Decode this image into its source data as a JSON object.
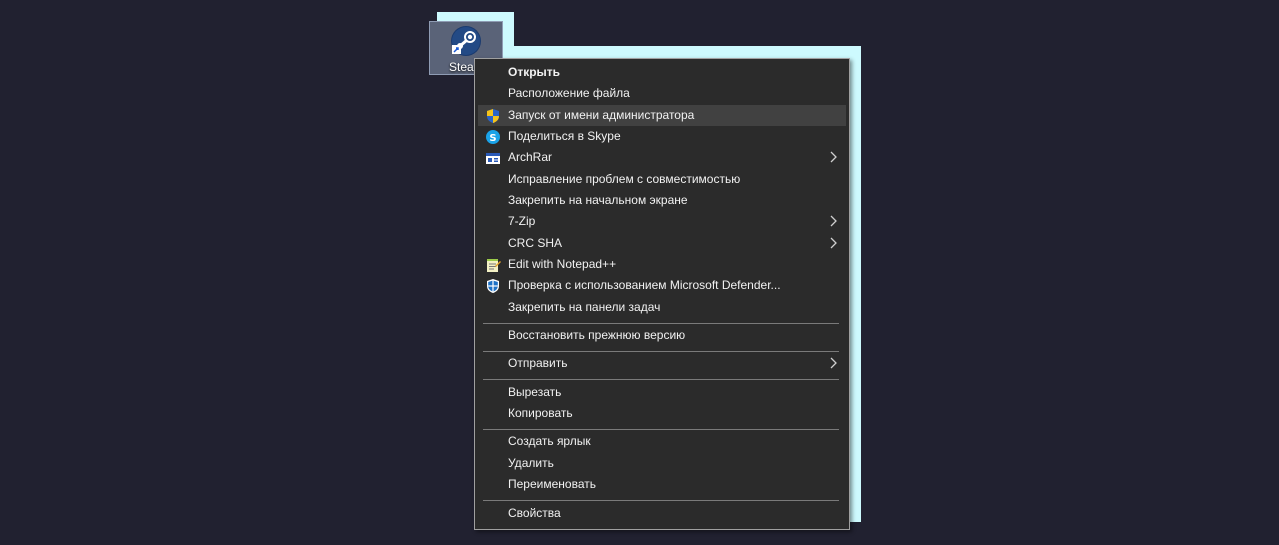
{
  "desktop_icon": {
    "label": "Steam",
    "icon": "steam-icon"
  },
  "context_menu": {
    "items": [
      {
        "label": "Открыть",
        "bold": true
      },
      {
        "label": "Расположение файла"
      },
      {
        "label": "Запуск от имени администратора",
        "icon": "uac-shield-icon",
        "highlighted": true
      },
      {
        "label": "Поделиться в Skype",
        "icon": "skype-icon"
      },
      {
        "label": "ArchRar",
        "icon": "archrar-icon",
        "submenu": true
      },
      {
        "label": "Исправление проблем с совместимостью"
      },
      {
        "label": "Закрепить на начальном экране"
      },
      {
        "label": "7-Zip",
        "submenu": true
      },
      {
        "label": "CRC SHA",
        "submenu": true
      },
      {
        "label": "Edit with Notepad++",
        "icon": "notepad-plus-plus-icon"
      },
      {
        "label": "Проверка с использованием Microsoft Defender...",
        "icon": "defender-icon"
      },
      {
        "label": "Закрепить на панели задач"
      },
      {
        "label": "Восстановить прежнюю версию"
      },
      {
        "label": "Отправить",
        "submenu": true
      },
      {
        "label": "Вырезать"
      },
      {
        "label": "Копировать"
      },
      {
        "label": "Создать ярлык"
      },
      {
        "label": "Удалить"
      },
      {
        "label": "Переименовать"
      },
      {
        "label": "Свойства"
      }
    ]
  },
  "colors": {
    "desktop_background": "#212130",
    "menu_background": "#2b2b2b",
    "menu_highlight": "#414141",
    "menu_text": "#f2f2f2",
    "highlight_glow": "#cdfafe"
  }
}
